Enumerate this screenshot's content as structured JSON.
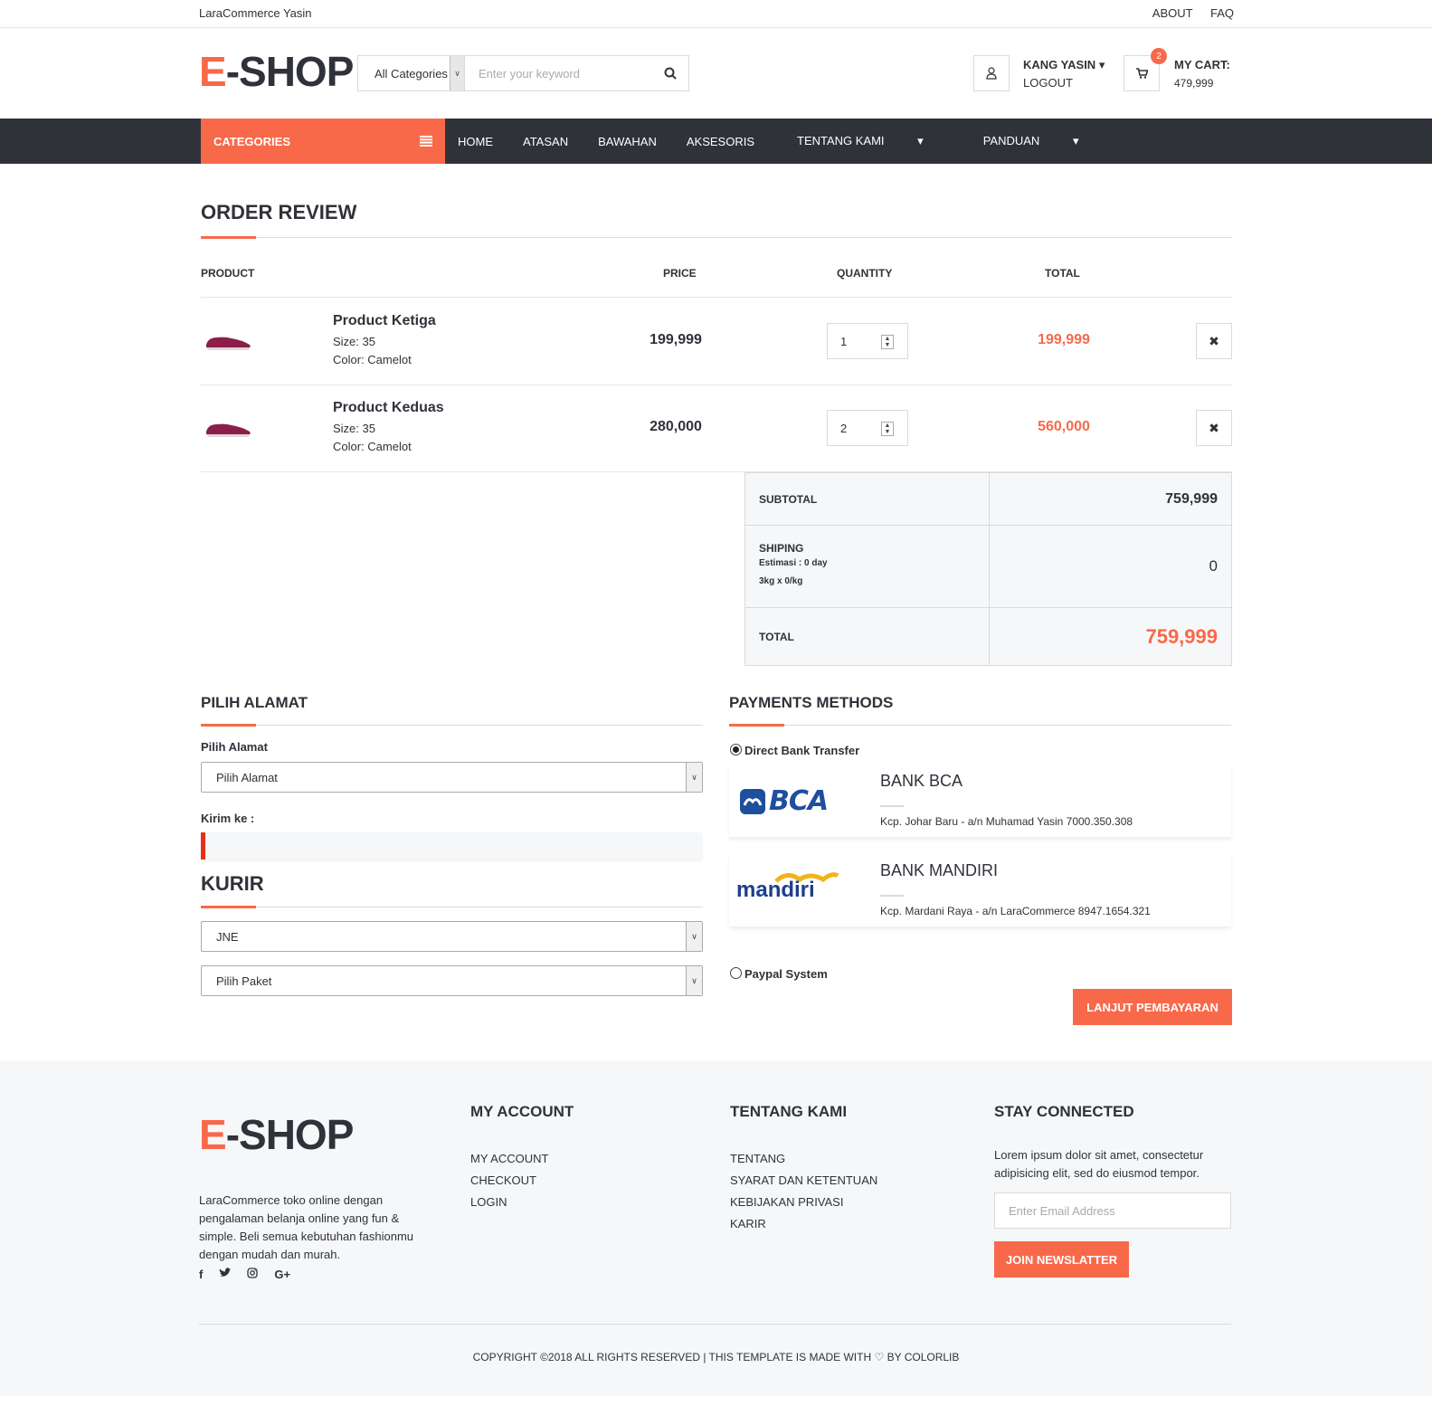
{
  "topbar": {
    "brand": "LaraCommerce Yasin",
    "links": [
      "ABOUT",
      "FAQ"
    ]
  },
  "header": {
    "logo_accent": "E",
    "logo_rest": "-SHOP",
    "search": {
      "category": "All Categories",
      "placeholder": "Enter your keyword"
    },
    "account": {
      "name": "KANG YASIN",
      "action": "LOGOUT"
    },
    "cart": {
      "count": "2",
      "label": "MY CART:",
      "amount": "479,999"
    }
  },
  "nav": {
    "categories_label": "CATEGORIES",
    "items": [
      "HOME",
      "ATASAN",
      "BAWAHAN",
      "AKSESORIS",
      "TENTANG KAMI",
      "PANDUAN"
    ]
  },
  "order": {
    "title": "ORDER REVIEW",
    "headers": {
      "product": "PRODUCT",
      "price": "PRICE",
      "quantity": "QUANTITY",
      "total": "TOTAL"
    },
    "items": [
      {
        "name": "Product Ketiga",
        "size": "Size: 35",
        "color": "Color: Camelot",
        "price": "199,999",
        "qty": "1",
        "total": "199,999"
      },
      {
        "name": "Product Keduas",
        "size": "Size: 35",
        "color": "Color: Camelot",
        "price": "280,000",
        "qty": "2",
        "total": "560,000"
      }
    ],
    "summary": {
      "subtotal_label": "SUBTOTAL",
      "subtotal": "759,999",
      "shipping_label": "SHIPING",
      "shipping_est": "Estimasi : 0 day",
      "shipping_rate": "3kg x 0/kg",
      "shipping": "0",
      "total_label": "TOTAL",
      "total": "759,999"
    }
  },
  "address": {
    "title": "PILIH ALAMAT",
    "label": "Pilih Alamat",
    "select": "Pilih Alamat",
    "send_label": "Kirim ke :"
  },
  "kurir": {
    "title": "KURIR",
    "courier": "JNE",
    "package": "Pilih Paket"
  },
  "payments": {
    "title": "PAYMENTS METHODS",
    "bank_transfer": "Direct Bank Transfer",
    "banks": [
      {
        "logo": "BCA",
        "name": "BANK BCA",
        "desc": "Kcp. Johar Baru - a/n Muhamad Yasin 7000.350.308"
      },
      {
        "logo": "mandiri",
        "name": "BANK MANDIRI",
        "desc": "Kcp. Mardani Raya - a/n LaraCommerce 8947.1654.321"
      }
    ],
    "paypal": "Paypal System",
    "continue": "LANJUT PEMBAYARAN"
  },
  "footer": {
    "logo_accent": "E",
    "logo_rest": "-SHOP",
    "desc": "LaraCommerce toko online dengan pengalaman belanja online yang fun & simple. Beli semua kebutuhan fashionmu dengan mudah dan murah.",
    "social_icons": [
      "facebook-icon",
      "twitter-icon",
      "instagram-icon",
      "google-plus-icon"
    ],
    "my_account": {
      "title": "MY ACCOUNT",
      "items": [
        "MY ACCOUNT",
        "CHECKOUT",
        "LOGIN"
      ]
    },
    "tentang": {
      "title": "TENTANG KAMI",
      "items": [
        "TENTANG",
        "SYARAT DAN KETENTUAN",
        "KEBIJAKAN PRIVASI",
        "KARIR"
      ]
    },
    "stay": {
      "title": "STAY CONNECTED",
      "text": "Lorem ipsum dolor sit amet, consectetur adipisicing elit, sed do eiusmod tempor.",
      "placeholder": "Enter Email Address",
      "button": "JOIN NEWSLATTER"
    },
    "copyright_pre": "COPYRIGHT ©2018 ALL RIGHTS RESERVED | THIS TEMPLATE IS MADE WITH",
    "copyright_post": "BY COLORLIB"
  },
  "colors": {
    "accent": "#f8694a",
    "dark": "#30323a",
    "light_bg": "#f6f7f8"
  }
}
